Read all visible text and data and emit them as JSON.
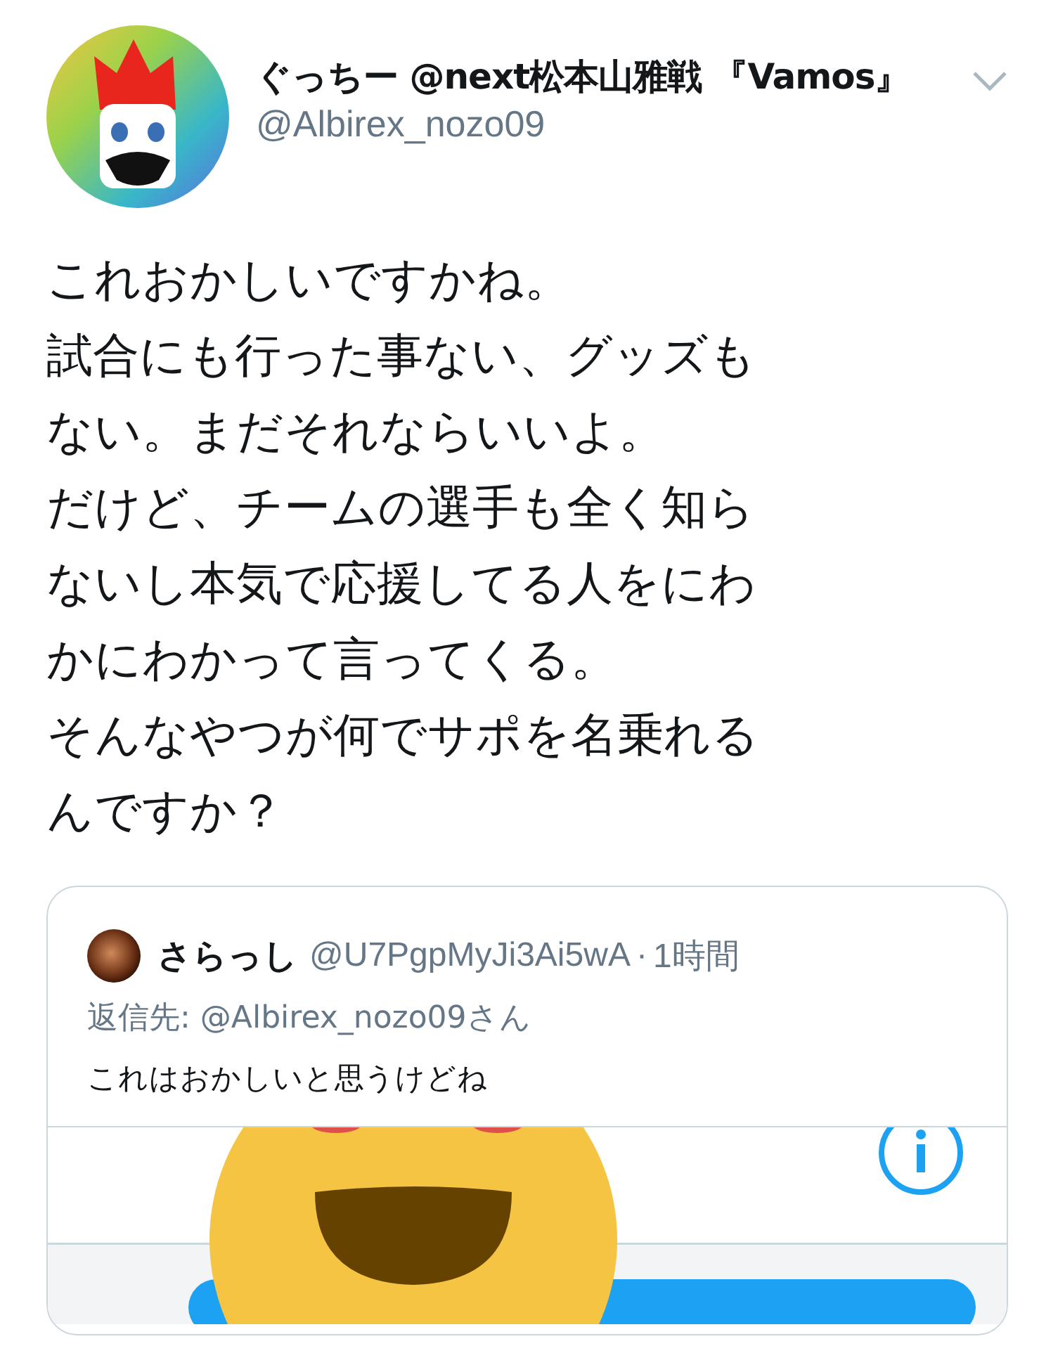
{
  "tweet": {
    "display_name": "ぐっちー @next松本山雅戦 『Vamos』",
    "handle": "@Albirex_nozo09",
    "body_lines": [
      "これおかしいですかね。",
      "試合にも行った事ない、グッズも",
      "ない。まだそれならいいよ。",
      "だけど、チームの選手も全く知ら",
      "ないし本気で応援してる人をにわ",
      "かにわかって言ってくる。",
      "そんなやつが何でサポを名乗れる",
      "んですか？"
    ],
    "quoted": {
      "display_name": "さらっし",
      "handle": "@U7PgpMyJi3Ai5wA",
      "separator": "·",
      "time": "1時間",
      "reply_to": "返信先: @Albirex_nozo09さん",
      "text": "これはおかしいと思うけどね"
    }
  }
}
